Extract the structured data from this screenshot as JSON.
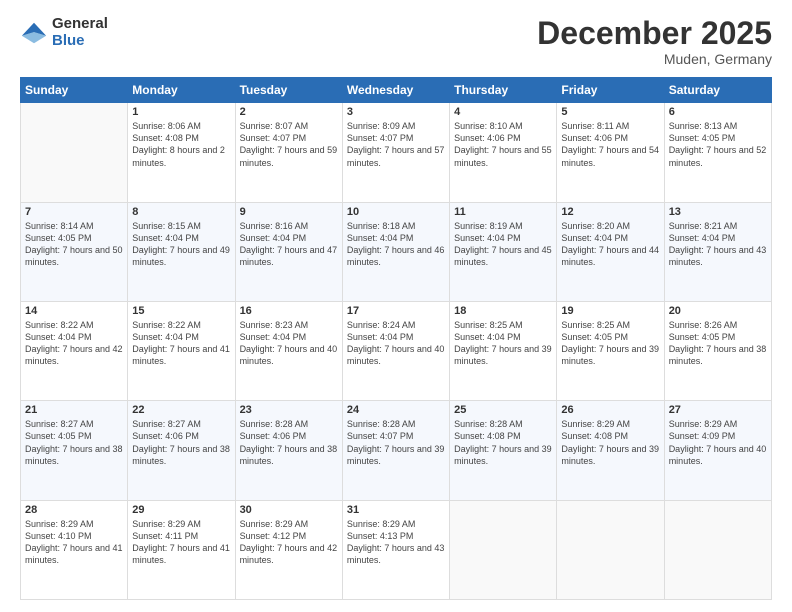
{
  "logo": {
    "general": "General",
    "blue": "Blue"
  },
  "header": {
    "month": "December 2025",
    "location": "Muden, Germany"
  },
  "days_header": [
    "Sunday",
    "Monday",
    "Tuesday",
    "Wednesday",
    "Thursday",
    "Friday",
    "Saturday"
  ],
  "weeks": [
    [
      {
        "day": "",
        "sunrise": "",
        "sunset": "",
        "daylight": ""
      },
      {
        "day": "1",
        "sunrise": "Sunrise: 8:06 AM",
        "sunset": "Sunset: 4:08 PM",
        "daylight": "Daylight: 8 hours and 2 minutes."
      },
      {
        "day": "2",
        "sunrise": "Sunrise: 8:07 AM",
        "sunset": "Sunset: 4:07 PM",
        "daylight": "Daylight: 7 hours and 59 minutes."
      },
      {
        "day": "3",
        "sunrise": "Sunrise: 8:09 AM",
        "sunset": "Sunset: 4:07 PM",
        "daylight": "Daylight: 7 hours and 57 minutes."
      },
      {
        "day": "4",
        "sunrise": "Sunrise: 8:10 AM",
        "sunset": "Sunset: 4:06 PM",
        "daylight": "Daylight: 7 hours and 55 minutes."
      },
      {
        "day": "5",
        "sunrise": "Sunrise: 8:11 AM",
        "sunset": "Sunset: 4:06 PM",
        "daylight": "Daylight: 7 hours and 54 minutes."
      },
      {
        "day": "6",
        "sunrise": "Sunrise: 8:13 AM",
        "sunset": "Sunset: 4:05 PM",
        "daylight": "Daylight: 7 hours and 52 minutes."
      }
    ],
    [
      {
        "day": "7",
        "sunrise": "Sunrise: 8:14 AM",
        "sunset": "Sunset: 4:05 PM",
        "daylight": "Daylight: 7 hours and 50 minutes."
      },
      {
        "day": "8",
        "sunrise": "Sunrise: 8:15 AM",
        "sunset": "Sunset: 4:04 PM",
        "daylight": "Daylight: 7 hours and 49 minutes."
      },
      {
        "day": "9",
        "sunrise": "Sunrise: 8:16 AM",
        "sunset": "Sunset: 4:04 PM",
        "daylight": "Daylight: 7 hours and 47 minutes."
      },
      {
        "day": "10",
        "sunrise": "Sunrise: 8:18 AM",
        "sunset": "Sunset: 4:04 PM",
        "daylight": "Daylight: 7 hours and 46 minutes."
      },
      {
        "day": "11",
        "sunrise": "Sunrise: 8:19 AM",
        "sunset": "Sunset: 4:04 PM",
        "daylight": "Daylight: 7 hours and 45 minutes."
      },
      {
        "day": "12",
        "sunrise": "Sunrise: 8:20 AM",
        "sunset": "Sunset: 4:04 PM",
        "daylight": "Daylight: 7 hours and 44 minutes."
      },
      {
        "day": "13",
        "sunrise": "Sunrise: 8:21 AM",
        "sunset": "Sunset: 4:04 PM",
        "daylight": "Daylight: 7 hours and 43 minutes."
      }
    ],
    [
      {
        "day": "14",
        "sunrise": "Sunrise: 8:22 AM",
        "sunset": "Sunset: 4:04 PM",
        "daylight": "Daylight: 7 hours and 42 minutes."
      },
      {
        "day": "15",
        "sunrise": "Sunrise: 8:22 AM",
        "sunset": "Sunset: 4:04 PM",
        "daylight": "Daylight: 7 hours and 41 minutes."
      },
      {
        "day": "16",
        "sunrise": "Sunrise: 8:23 AM",
        "sunset": "Sunset: 4:04 PM",
        "daylight": "Daylight: 7 hours and 40 minutes."
      },
      {
        "day": "17",
        "sunrise": "Sunrise: 8:24 AM",
        "sunset": "Sunset: 4:04 PM",
        "daylight": "Daylight: 7 hours and 40 minutes."
      },
      {
        "day": "18",
        "sunrise": "Sunrise: 8:25 AM",
        "sunset": "Sunset: 4:04 PM",
        "daylight": "Daylight: 7 hours and 39 minutes."
      },
      {
        "day": "19",
        "sunrise": "Sunrise: 8:25 AM",
        "sunset": "Sunset: 4:05 PM",
        "daylight": "Daylight: 7 hours and 39 minutes."
      },
      {
        "day": "20",
        "sunrise": "Sunrise: 8:26 AM",
        "sunset": "Sunset: 4:05 PM",
        "daylight": "Daylight: 7 hours and 38 minutes."
      }
    ],
    [
      {
        "day": "21",
        "sunrise": "Sunrise: 8:27 AM",
        "sunset": "Sunset: 4:05 PM",
        "daylight": "Daylight: 7 hours and 38 minutes."
      },
      {
        "day": "22",
        "sunrise": "Sunrise: 8:27 AM",
        "sunset": "Sunset: 4:06 PM",
        "daylight": "Daylight: 7 hours and 38 minutes."
      },
      {
        "day": "23",
        "sunrise": "Sunrise: 8:28 AM",
        "sunset": "Sunset: 4:06 PM",
        "daylight": "Daylight: 7 hours and 38 minutes."
      },
      {
        "day": "24",
        "sunrise": "Sunrise: 8:28 AM",
        "sunset": "Sunset: 4:07 PM",
        "daylight": "Daylight: 7 hours and 39 minutes."
      },
      {
        "day": "25",
        "sunrise": "Sunrise: 8:28 AM",
        "sunset": "Sunset: 4:08 PM",
        "daylight": "Daylight: 7 hours and 39 minutes."
      },
      {
        "day": "26",
        "sunrise": "Sunrise: 8:29 AM",
        "sunset": "Sunset: 4:08 PM",
        "daylight": "Daylight: 7 hours and 39 minutes."
      },
      {
        "day": "27",
        "sunrise": "Sunrise: 8:29 AM",
        "sunset": "Sunset: 4:09 PM",
        "daylight": "Daylight: 7 hours and 40 minutes."
      }
    ],
    [
      {
        "day": "28",
        "sunrise": "Sunrise: 8:29 AM",
        "sunset": "Sunset: 4:10 PM",
        "daylight": "Daylight: 7 hours and 41 minutes."
      },
      {
        "day": "29",
        "sunrise": "Sunrise: 8:29 AM",
        "sunset": "Sunset: 4:11 PM",
        "daylight": "Daylight: 7 hours and 41 minutes."
      },
      {
        "day": "30",
        "sunrise": "Sunrise: 8:29 AM",
        "sunset": "Sunset: 4:12 PM",
        "daylight": "Daylight: 7 hours and 42 minutes."
      },
      {
        "day": "31",
        "sunrise": "Sunrise: 8:29 AM",
        "sunset": "Sunset: 4:13 PM",
        "daylight": "Daylight: 7 hours and 43 minutes."
      },
      {
        "day": "",
        "sunrise": "",
        "sunset": "",
        "daylight": ""
      },
      {
        "day": "",
        "sunrise": "",
        "sunset": "",
        "daylight": ""
      },
      {
        "day": "",
        "sunrise": "",
        "sunset": "",
        "daylight": ""
      }
    ]
  ]
}
